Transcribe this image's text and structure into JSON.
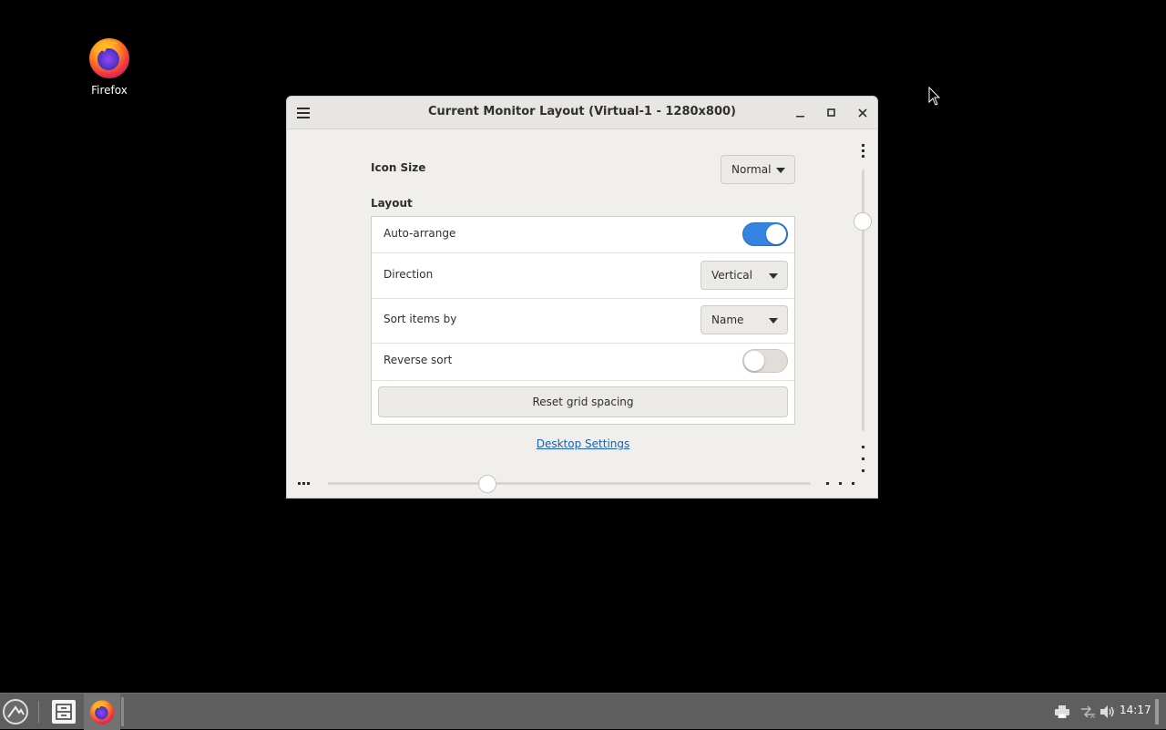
{
  "desktop": {
    "icons": [
      {
        "label": "Firefox",
        "icon": "firefox-icon"
      }
    ]
  },
  "window": {
    "title": "Current Monitor Layout (Virtual-1 - 1280x800)",
    "icon_size_label": "Icon Size",
    "icon_size_value": "Normal",
    "layout_label": "Layout",
    "rows": {
      "auto_arrange": {
        "label": "Auto-arrange",
        "enabled": true
      },
      "direction": {
        "label": "Direction",
        "value": "Vertical"
      },
      "sort_by": {
        "label": "Sort items by",
        "value": "Name"
      },
      "reverse_sort": {
        "label": "Reverse sort",
        "enabled": false
      }
    },
    "reset_button": "Reset grid spacing",
    "settings_link": "Desktop Settings",
    "vertical_slider_level": 0.2,
    "horizontal_slider_level": 0.33
  },
  "taskbar": {
    "clock": "14:17",
    "apps": [
      "menu-icon",
      "file-manager-icon",
      "firefox-icon"
    ],
    "tray_icons": [
      "printer-icon",
      "network-icon",
      "volume-icon"
    ]
  },
  "colors": {
    "accent": "#3584e4",
    "link": "#1a5fb4",
    "window_bg": "#f1efeb",
    "taskbar_bg": "#5e5e5e"
  }
}
